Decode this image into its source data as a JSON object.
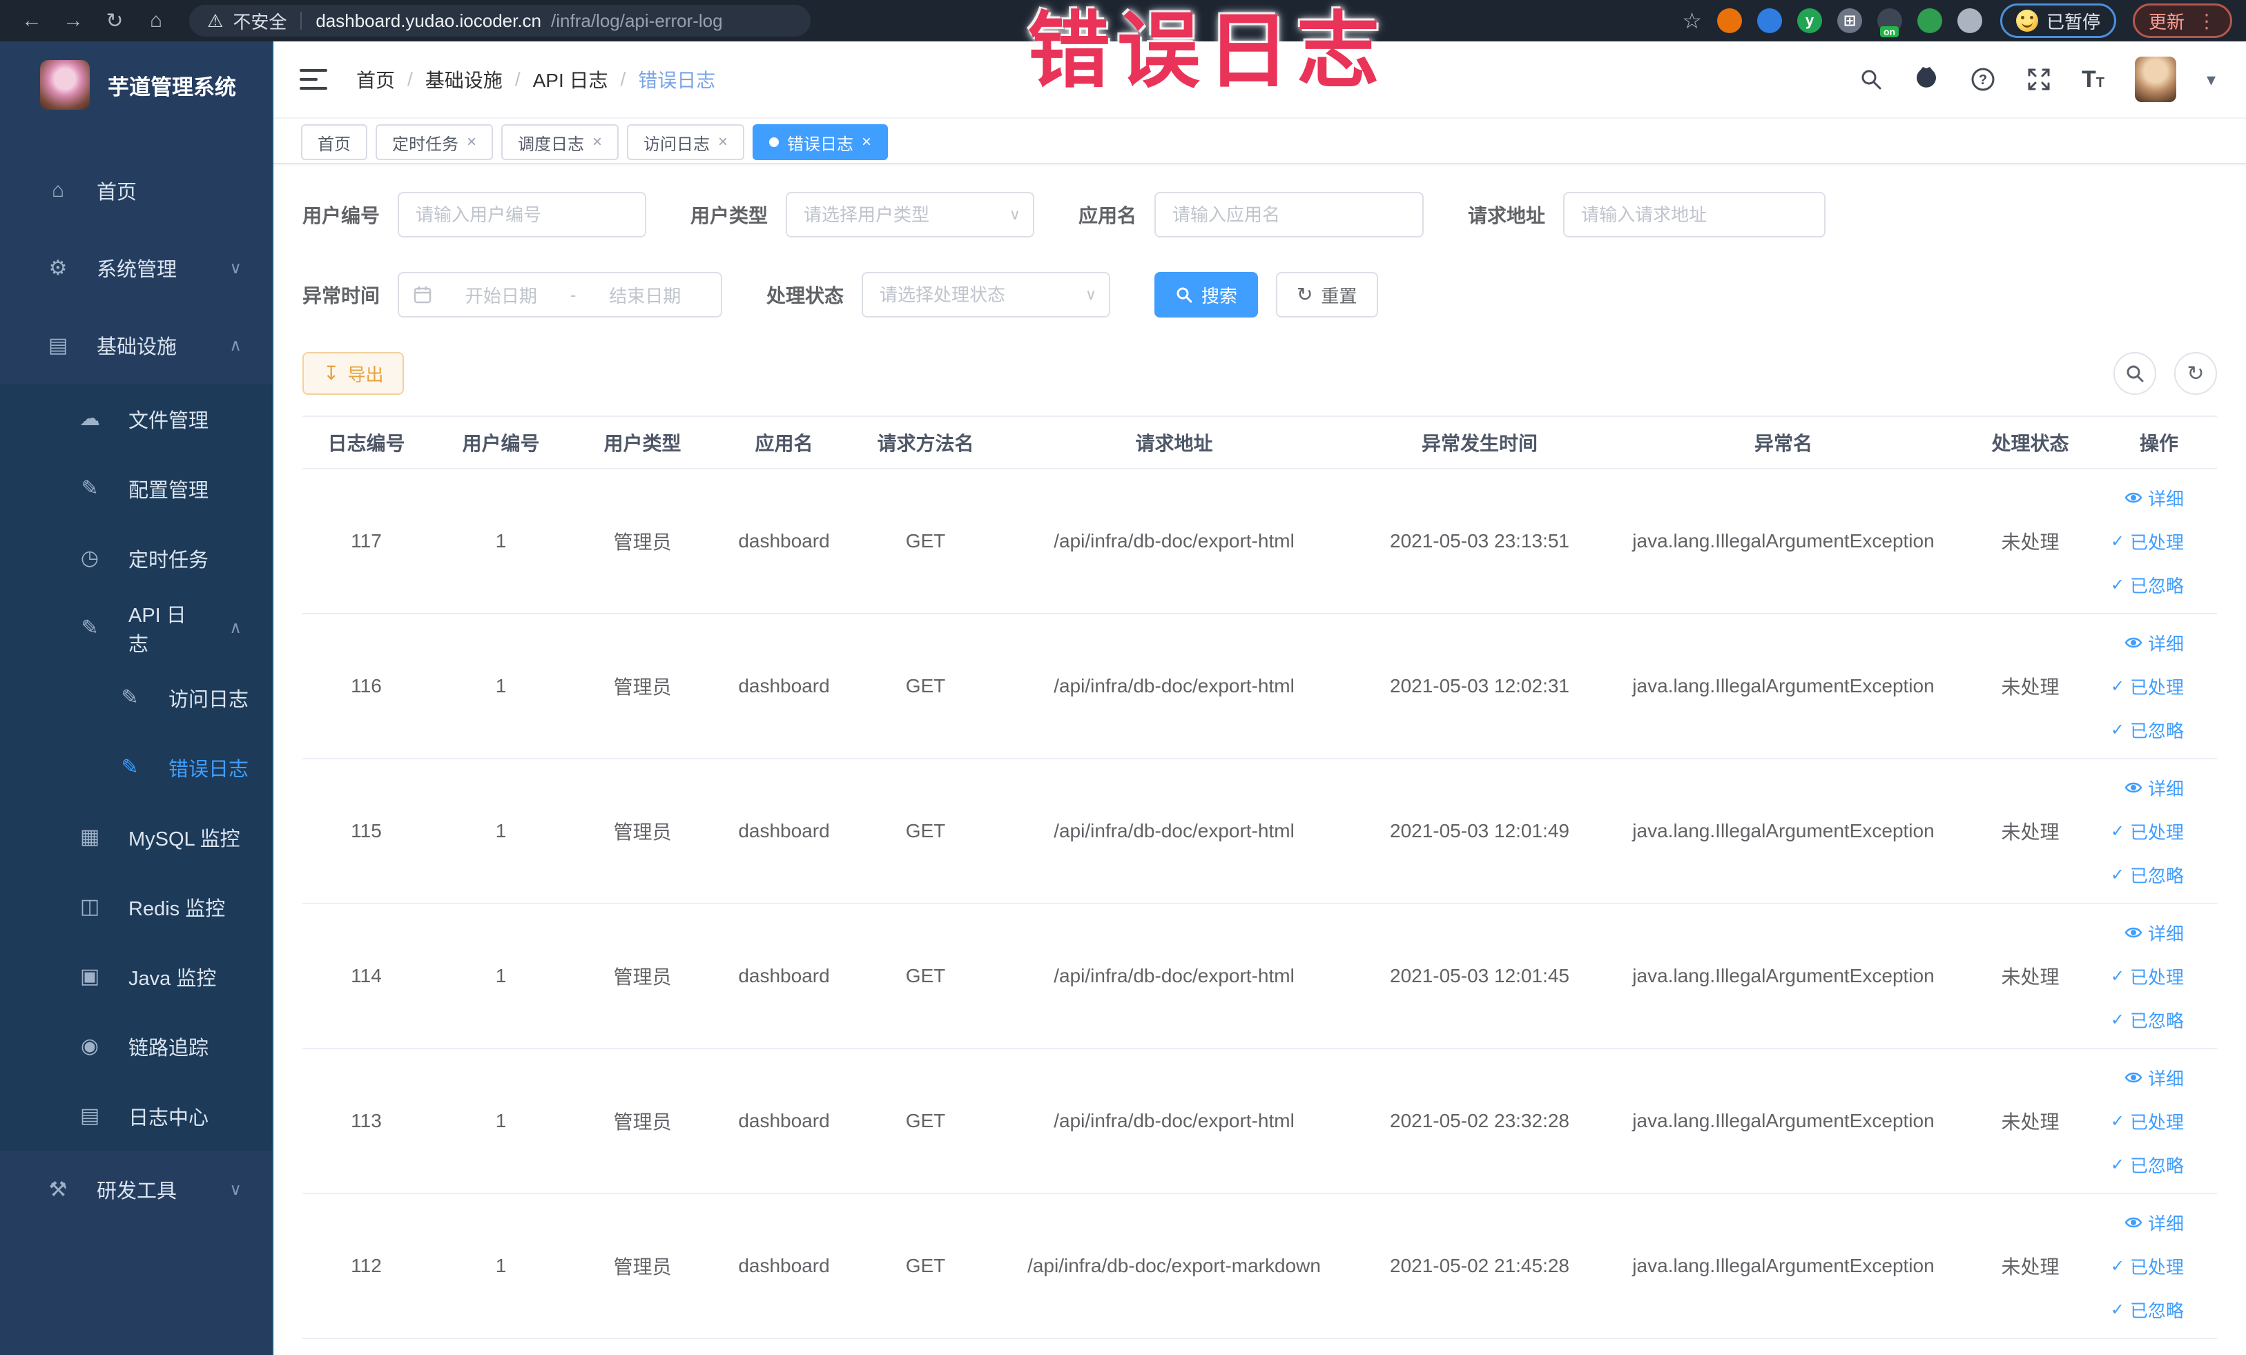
{
  "watermark": "错误日志",
  "browser": {
    "security_label": "不安全",
    "url_domain": "dashboard.yudao.iocoder.cn",
    "url_path": "/infra/log/api-error-log",
    "paused_label": "已暂停",
    "update_label": "更新",
    "extensions": [
      {
        "key": "extension-orange",
        "color": "#e8710a"
      },
      {
        "key": "extension-shield",
        "color": "#2f7de1"
      },
      {
        "key": "extension-green-y",
        "color": "#23a455",
        "letter": "y"
      },
      {
        "key": "extension-grid",
        "color": "#6d7685",
        "letter": "⊞"
      },
      {
        "key": "extension-on-badge",
        "color": "#3c4654",
        "badge": "on"
      },
      {
        "key": "extension-plant",
        "color": "#2f9e4f"
      },
      {
        "key": "extension-puzzle",
        "color": "#aab3bf"
      }
    ]
  },
  "sidebar": {
    "title": "芋道管理系统",
    "items": [
      {
        "key": "home",
        "label": "首页",
        "icon": "home-icon"
      },
      {
        "key": "system-management",
        "label": "系统管理",
        "icon": "gear-icon",
        "chevron": "down"
      },
      {
        "key": "infrastructure",
        "label": "基础设施",
        "icon": "infra-icon",
        "chevron": "up",
        "children": [
          {
            "key": "file-management",
            "label": "文件管理",
            "icon": "cloud-upload-icon"
          },
          {
            "key": "config-management",
            "label": "配置管理",
            "icon": "edit-icon"
          },
          {
            "key": "scheduled-tasks",
            "label": "定时任务",
            "icon": "timer-icon"
          },
          {
            "key": "api-log",
            "label": "API 日志",
            "icon": "log-edit-icon",
            "chevron": "up",
            "children": [
              {
                "key": "access-log",
                "label": "访问日志",
                "icon": "log-edit-icon"
              },
              {
                "key": "error-log",
                "label": "错误日志",
                "icon": "log-edit-icon",
                "active": true
              }
            ]
          },
          {
            "key": "mysql-monitor",
            "label": "MySQL 监控",
            "icon": "mysql-icon"
          },
          {
            "key": "redis-monitor",
            "label": "Redis 监控",
            "icon": "redis-icon"
          },
          {
            "key": "java-monitor",
            "label": "Java 监控",
            "icon": "java-icon"
          },
          {
            "key": "trace",
            "label": "链路追踪",
            "icon": "trace-eye-icon"
          },
          {
            "key": "log-center",
            "label": "日志中心",
            "icon": "log-center-icon"
          }
        ]
      },
      {
        "key": "dev-tools",
        "label": "研发工具",
        "icon": "devtools-icon",
        "chevron": "down"
      }
    ]
  },
  "header": {
    "breadcrumb": [
      "首页",
      "基础设施",
      "API 日志",
      "错误日志"
    ]
  },
  "tabs": [
    {
      "key": "home",
      "label": "首页",
      "closable": false,
      "active": false
    },
    {
      "key": "scheduled-tasks",
      "label": "定时任务",
      "closable": true,
      "active": false
    },
    {
      "key": "schedule-log",
      "label": "调度日志",
      "closable": true,
      "active": false
    },
    {
      "key": "access-log",
      "label": "访问日志",
      "closable": true,
      "active": false
    },
    {
      "key": "error-log",
      "label": "错误日志",
      "closable": true,
      "active": true
    }
  ],
  "filters": {
    "user_id": {
      "label": "用户编号",
      "placeholder": "请输入用户编号"
    },
    "user_type": {
      "label": "用户类型",
      "placeholder": "请选择用户类型"
    },
    "app_name": {
      "label": "应用名",
      "placeholder": "请输入应用名"
    },
    "request_url": {
      "label": "请求地址",
      "placeholder": "请输入请求地址"
    },
    "error_time": {
      "label": "异常时间",
      "start_placeholder": "开始日期",
      "separator": "-",
      "end_placeholder": "结束日期"
    },
    "process_status": {
      "label": "处理状态",
      "placeholder": "请选择处理状态"
    },
    "search_label": "搜索",
    "reset_label": "重置"
  },
  "toolbar": {
    "export_label": "导出"
  },
  "table": {
    "columns": [
      "日志编号",
      "用户编号",
      "用户类型",
      "应用名",
      "请求方法名",
      "请求地址",
      "异常发生时间",
      "异常名",
      "处理状态",
      "操作"
    ],
    "column_keys": [
      "log_id",
      "user_id",
      "user_type",
      "app_name",
      "method",
      "request_url",
      "error_time",
      "exception_name",
      "status",
      "actions"
    ],
    "actions": [
      {
        "key": "detail",
        "label": "详细",
        "icon": "eye-icon"
      },
      {
        "key": "mark-processed",
        "label": "已处理",
        "icon": "check-icon"
      },
      {
        "key": "mark-ignored",
        "label": "已忽略",
        "icon": "check-icon"
      }
    ],
    "rows": [
      {
        "log_id": "117",
        "user_id": "1",
        "user_type": "管理员",
        "app_name": "dashboard",
        "method": "GET",
        "request_url": "/api/infra/db-doc/export-html",
        "error_time": "2021-05-03 23:13:51",
        "exception_name": "java.lang.IllegalArgumentException",
        "status": "未处理"
      },
      {
        "log_id": "116",
        "user_id": "1",
        "user_type": "管理员",
        "app_name": "dashboard",
        "method": "GET",
        "request_url": "/api/infra/db-doc/export-html",
        "error_time": "2021-05-03 12:02:31",
        "exception_name": "java.lang.IllegalArgumentException",
        "status": "未处理"
      },
      {
        "log_id": "115",
        "user_id": "1",
        "user_type": "管理员",
        "app_name": "dashboard",
        "method": "GET",
        "request_url": "/api/infra/db-doc/export-html",
        "error_time": "2021-05-03 12:01:49",
        "exception_name": "java.lang.IllegalArgumentException",
        "status": "未处理"
      },
      {
        "log_id": "114",
        "user_id": "1",
        "user_type": "管理员",
        "app_name": "dashboard",
        "method": "GET",
        "request_url": "/api/infra/db-doc/export-html",
        "error_time": "2021-05-03 12:01:45",
        "exception_name": "java.lang.IllegalArgumentException",
        "status": "未处理"
      },
      {
        "log_id": "113",
        "user_id": "1",
        "user_type": "管理员",
        "app_name": "dashboard",
        "method": "GET",
        "request_url": "/api/infra/db-doc/export-html",
        "error_time": "2021-05-02 23:32:28",
        "exception_name": "java.lang.IllegalArgumentException",
        "status": "未处理"
      },
      {
        "log_id": "112",
        "user_id": "1",
        "user_type": "管理员",
        "app_name": "dashboard",
        "method": "GET",
        "request_url": "/api/infra/db-doc/export-markdown",
        "error_time": "2021-05-02 21:45:28",
        "exception_name": "java.lang.IllegalArgumentException",
        "status": "未处理"
      }
    ]
  },
  "colors": {
    "accent": "#409eff",
    "export": "#e6a23c",
    "watermark": "#ea3358",
    "sidebar": "#253e60",
    "submenu": "#1d3a58"
  }
}
